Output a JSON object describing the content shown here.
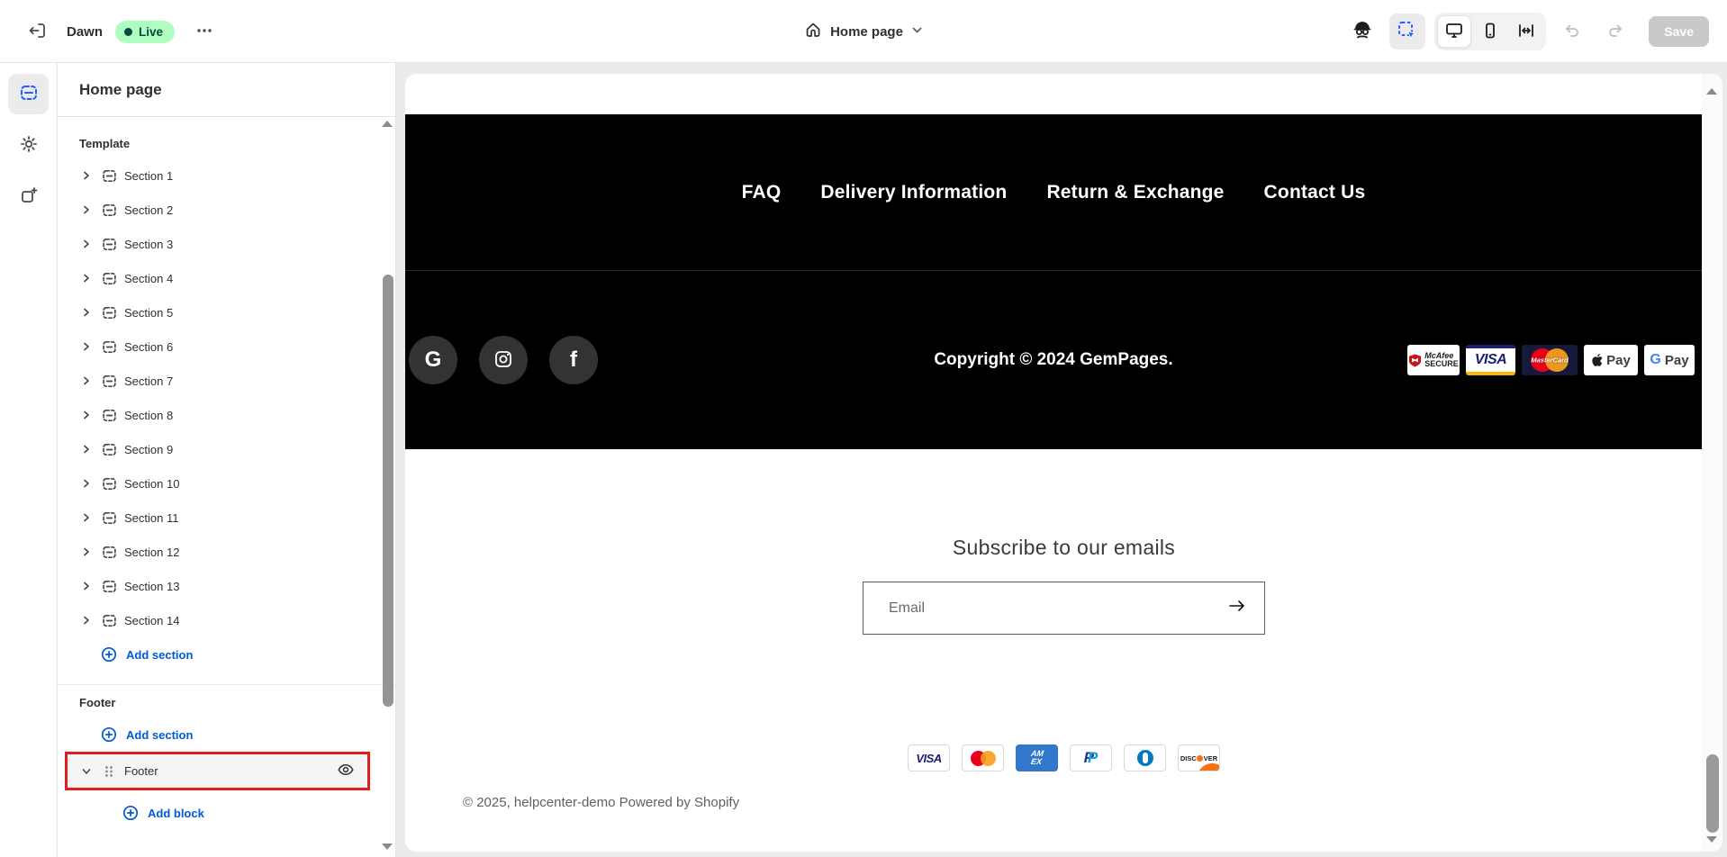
{
  "topbar": {
    "theme_name": "Dawn",
    "live_badge": "Live",
    "page_selector": "Home page",
    "save_label": "Save"
  },
  "sidebar": {
    "title": "Home page",
    "template_label": "Template",
    "sections": [
      "Section 1",
      "Section 2",
      "Section 3",
      "Section 4",
      "Section 5",
      "Section 6",
      "Section 7",
      "Section 8",
      "Section 9",
      "Section 10",
      "Section 11",
      "Section 12",
      "Section 13",
      "Section 14"
    ],
    "add_section_label": "Add section",
    "footer_group_label": "Footer",
    "footer_add_section_label": "Add section",
    "footer_row_label": "Footer",
    "add_block_label": "Add block"
  },
  "preview": {
    "black_footer": {
      "menu": [
        "FAQ",
        "Delivery Information",
        "Return & Exchange",
        "Contact Us"
      ],
      "social_glyphs": {
        "google": "G",
        "facebook": "f"
      },
      "copyright": "Copyright © 2024 GemPages.",
      "badges": {
        "mcafee_line1": "McAfee",
        "mcafee_line2": "SECURE",
        "visa": "VISA",
        "mastercard": "MasterCard",
        "apple_pay": "Pay",
        "g_pay_g": "G",
        "g_pay": "Pay"
      }
    },
    "newsletter": {
      "heading": "Subscribe to our emails",
      "email_placeholder": "Email"
    },
    "payments": {
      "visa": "VISA",
      "amex_line1": "AM",
      "amex_line2": "EX",
      "paypal_p": "P",
      "discover_left": "DISC",
      "discover_right": "VER"
    },
    "bottom_copyright": "© 2025, helpcenter-demo",
    "powered_by": "Powered by Shopify"
  },
  "colors": {
    "accent_blue": "#005bd3",
    "rail_active_blue": "#1f5eff",
    "live_badge_bg": "#affebf",
    "live_badge_text": "#014b40",
    "selection_red": "#e11d1d",
    "footer_bg": "#000000"
  }
}
